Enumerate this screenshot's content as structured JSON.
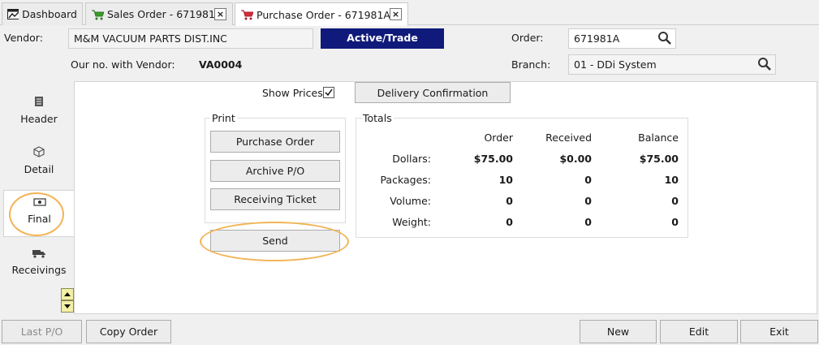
{
  "tabs": [
    {
      "label": "Dashboard",
      "icon": "dashboard-icon"
    },
    {
      "label": "Sales Order - 671981",
      "icon": "green-cart-icon"
    },
    {
      "label": "Purchase Order - 671981A",
      "icon": "red-cart-icon"
    }
  ],
  "header": {
    "vendor_label": "Vendor:",
    "vendor_value": "M&M VACUUM PARTS DIST.INC",
    "status": "Active/Trade",
    "order_label": "Order:",
    "order_value": "671981A",
    "our_no_label": "Our no. with Vendor:",
    "our_no_value": "VA0004",
    "branch_label": "Branch:",
    "branch_value": "01 - DDi System"
  },
  "nav": {
    "header": "Header",
    "detail": "Detail",
    "final": "Final",
    "receivings": "Receivings"
  },
  "main": {
    "show_prices_label": "Show Prices",
    "show_prices_checked": true,
    "delivery_confirmation": "Delivery Confirmation",
    "print_legend": "Print",
    "print_buttons": [
      "Purchase Order",
      "Archive P/O",
      "Receiving Ticket"
    ],
    "send": "Send",
    "totals_legend": "Totals",
    "totals": {
      "columns": [
        "Order",
        "Received",
        "Balance"
      ],
      "rows": [
        {
          "label": "Dollars:",
          "values": [
            "$75.00",
            "$0.00",
            "$75.00"
          ]
        },
        {
          "label": "Packages:",
          "values": [
            "10",
            "0",
            "10"
          ]
        },
        {
          "label": "Volume:",
          "values": [
            "0",
            "0",
            "0"
          ]
        },
        {
          "label": "Weight:",
          "values": [
            "0",
            "0",
            "0"
          ]
        }
      ]
    }
  },
  "footer": {
    "last_po": "Last P/O",
    "copy_order": "Copy Order",
    "new": "New",
    "edit": "Edit",
    "exit": "Exit"
  },
  "colors": {
    "status_bg": "#101a7a",
    "highlight": "#f2b455",
    "scroll_btn": "#f3f0a6"
  }
}
